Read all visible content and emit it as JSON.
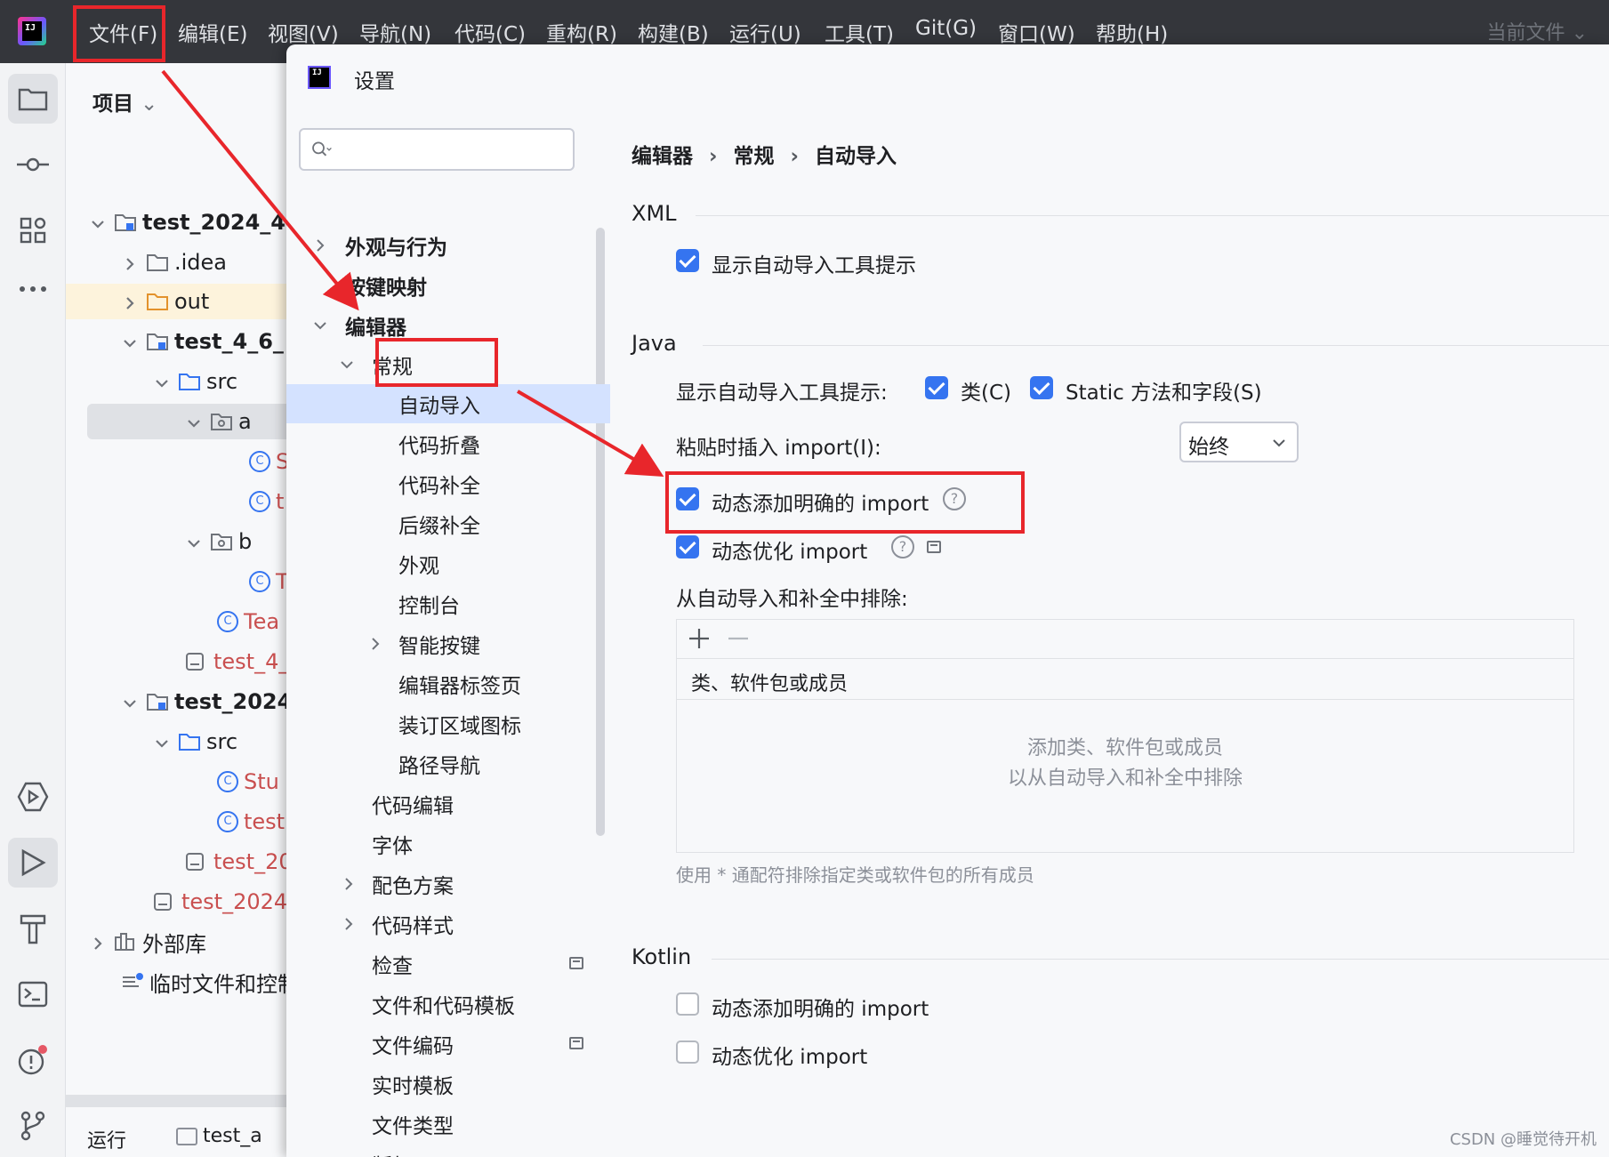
{
  "menubar": {
    "items": [
      "文件(F)",
      "编辑(E)",
      "视图(V)",
      "导航(N)",
      "代码(C)",
      "重构(R)",
      "构建(B)",
      "运行(U)",
      "工具(T)",
      "Git(G)",
      "窗口(W)",
      "帮助(H)"
    ],
    "current_file": "当前文件",
    "logo_text": "IJ"
  },
  "project": {
    "title": "项目",
    "rows": [
      "test_2024_4",
      ".idea",
      "out",
      "test_4_6_",
      "src",
      "a",
      "S",
      "t",
      "b",
      "T",
      "Tea",
      "test_4_",
      "test_2024",
      "src",
      "Stu",
      "test",
      "test_20",
      "test_2024",
      "外部库",
      "临时文件和控制"
    ],
    "run_label": "运行",
    "run_config": "test_a"
  },
  "dialog": {
    "title": "设置",
    "search_placeholder": "",
    "nav": [
      "外观与行为",
      "按键映射",
      "编辑器",
      "常规",
      "自动导入",
      "代码折叠",
      "代码补全",
      "后缀补全",
      "外观",
      "控制台",
      "智能按键",
      "编辑器标签页",
      "装订区域图标",
      "路径导航",
      "代码编辑",
      "字体",
      "配色方案",
      "代码样式",
      "检查",
      "文件和代码模板",
      "文件编码",
      "实时模板",
      "文件类型",
      "版权"
    ],
    "breadcrumb": [
      "编辑器",
      "常规",
      "自动导入"
    ],
    "breadcrumb_sep": "›",
    "xml": {
      "title": "XML",
      "show_tooltip": "显示自动导入工具提示"
    },
    "java": {
      "title": "Java",
      "tooltip_label": "显示自动导入工具提示:",
      "classes": "类(C)",
      "static": "Static 方法和字段(S)",
      "paste_label": "粘贴时插入 import(I):",
      "paste_value": "始终",
      "add_unambiguous": "动态添加明确的 import",
      "optimize": "动态优化 import",
      "exclude_label": "从自动导入和补全中排除:",
      "exclude_col": "类、软件包或成员",
      "exclude_empty_1": "添加类、软件包或成员",
      "exclude_empty_2": "以从自动导入和补全中排除",
      "exclude_hint": "使用 * 通配符排除指定类或软件包的所有成员",
      "help_glyph": "?"
    },
    "kotlin": {
      "title": "Kotlin",
      "add_unambiguous": "动态添加明确的 import",
      "optimize": "动态优化 import"
    }
  },
  "watermark": "CSDN @睡觉待开机",
  "colors": {
    "accent": "#3574f0",
    "annotation": "#e8262b"
  }
}
